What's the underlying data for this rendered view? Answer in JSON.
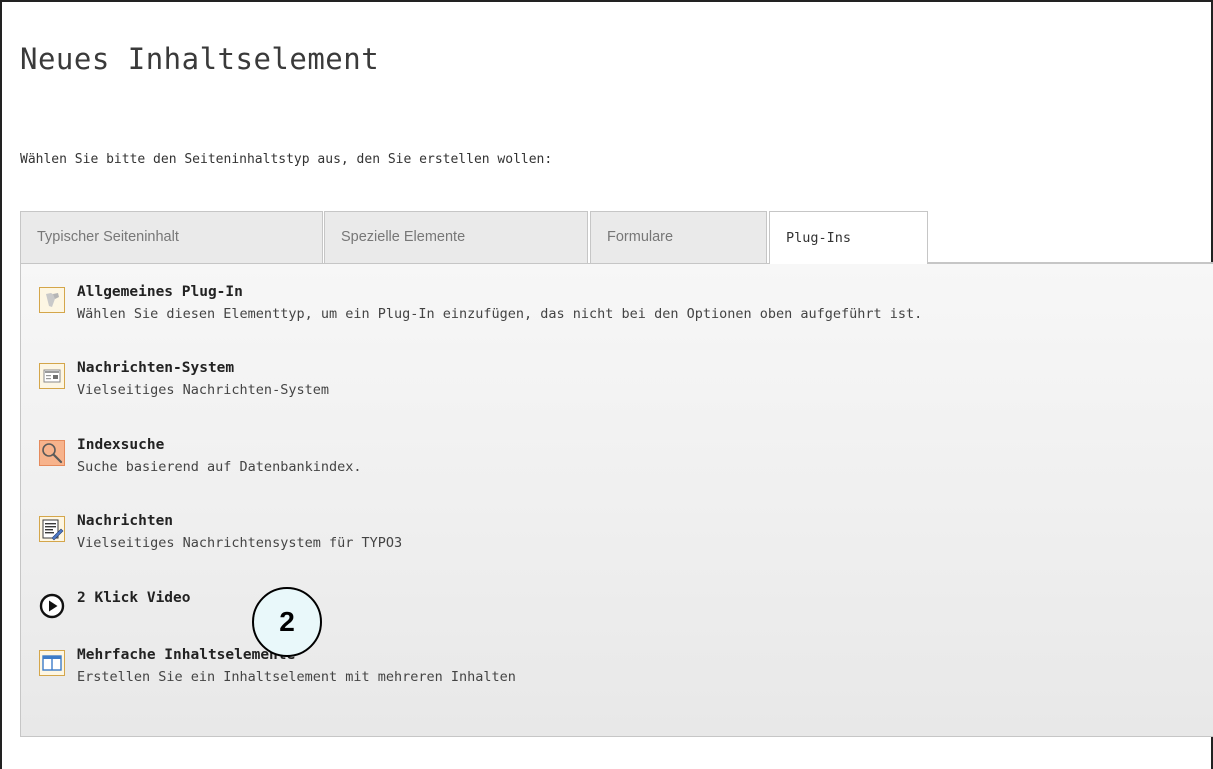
{
  "title": "Neues Inhaltselement",
  "instruction": "Wählen Sie bitte den Seiteninhaltstyp aus, den Sie erstellen wollen:",
  "tabs": [
    {
      "label": "Typischer Seiteninhalt",
      "active": false
    },
    {
      "label": "Spezielle Elemente",
      "active": false
    },
    {
      "label": "Formulare",
      "active": false
    },
    {
      "label": "Plug-Ins",
      "active": true
    }
  ],
  "items": [
    {
      "title": "Allgemeines Plug-In",
      "description": "Wählen Sie diesen Elementtyp, um ein Plug-In einzufügen, das nicht bei den Optionen oben aufgeführt ist.",
      "icon": "plugin-icon"
    },
    {
      "title": "Nachrichten-System",
      "description": "Vielseitiges Nachrichten-System",
      "icon": "news-system-icon"
    },
    {
      "title": "Indexsuche",
      "description": "Suche basierend auf Datenbankindex.",
      "icon": "magnifier-icon"
    },
    {
      "title": "Nachrichten",
      "description": "Vielseitiges Nachrichtensystem für TYPO3",
      "icon": "news-document-icon"
    },
    {
      "title": "2 Klick Video",
      "description": "",
      "icon": "play-circle-icon"
    },
    {
      "title": "Mehrfache Inhaltselemente",
      "description": "Erstellen Sie ein Inhaltselement mit mehreren Inhalten",
      "icon": "columns-icon"
    }
  ],
  "callout": {
    "label": "2"
  },
  "colors": {
    "icon_border": "#d4a64a",
    "icon_fill": "#fdf6e3",
    "search_icon_fill": "#f7b38c",
    "callout_fill": "#e9f8fa"
  }
}
